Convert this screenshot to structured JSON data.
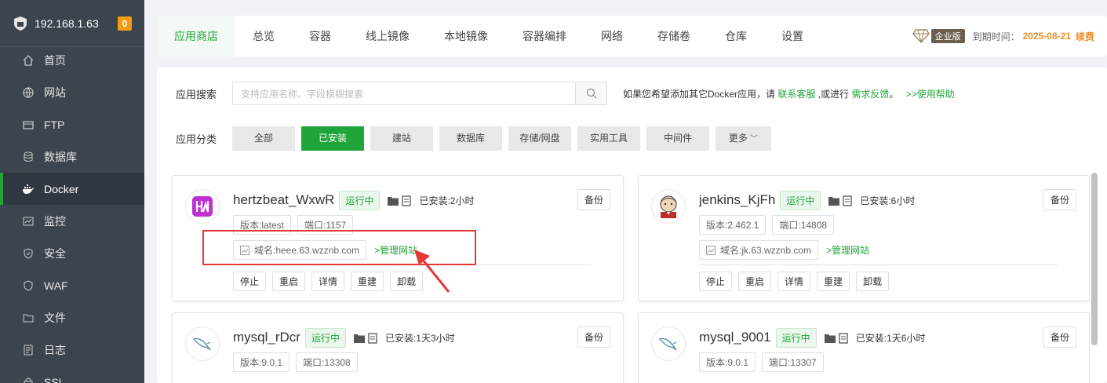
{
  "sidebar": {
    "server_ip": "192.168.1.63",
    "badge": "0",
    "items": [
      {
        "label": "首页",
        "icon": "home-icon"
      },
      {
        "label": "网站",
        "icon": "globe-icon"
      },
      {
        "label": "FTP",
        "icon": "ftp-icon"
      },
      {
        "label": "数据库",
        "icon": "database-icon"
      },
      {
        "label": "Docker",
        "icon": "docker-icon",
        "active": true
      },
      {
        "label": "监控",
        "icon": "monitor-icon"
      },
      {
        "label": "安全",
        "icon": "shield-icon"
      },
      {
        "label": "WAF",
        "icon": "waf-icon"
      },
      {
        "label": "文件",
        "icon": "folder-icon"
      },
      {
        "label": "日志",
        "icon": "log-icon"
      },
      {
        "label": "SSL",
        "icon": "ssl-icon"
      }
    ]
  },
  "tabs": [
    "应用商店",
    "总览",
    "容器",
    "线上镜像",
    "本地镜像",
    "容器编排",
    "网络",
    "存储卷",
    "仓库",
    "设置"
  ],
  "enterprise": {
    "tag": "企业版",
    "expire_label": "到期时间：",
    "date": "2025-08-21",
    "renew": "续费"
  },
  "search": {
    "label": "应用搜索",
    "placeholder": "支持应用名称、字段模糊搜索",
    "hint_prefix": "如果您希望添加其它Docker应用，请 ",
    "hint_link1": "联系客服",
    "hint_mid": " ,或进行 ",
    "hint_link2": "需求反馈",
    "hint_sep": "。 ",
    "hint_link3": ">>使用帮助"
  },
  "category": {
    "label": "应用分类",
    "items": [
      "全部",
      "已安装",
      "建站",
      "数据库",
      "存储/网盘",
      "实用工具",
      "中间件",
      "更多"
    ],
    "active": "已安装"
  },
  "apps": [
    {
      "name": "hertzbeat_WxwR",
      "status": "运行中",
      "installed": "已安装:2小时",
      "version": "版本:latest",
      "port": "端口:1157",
      "domain": "域名:heee.63.wzznb.com",
      "manage": ">管理网站",
      "backup": "备份",
      "actions": [
        "停止",
        "重启",
        "详情",
        "重建",
        "卸载"
      ]
    },
    {
      "name": "jenkins_KjFh",
      "status": "运行中",
      "installed": "已安装:6小时",
      "version": "版本:2.462.1",
      "port": "端口:14808",
      "domain": "域名:jk.63.wzznb.com",
      "manage": ">管理网站",
      "backup": "备份",
      "actions": [
        "停止",
        "重启",
        "详情",
        "重建",
        "卸载"
      ]
    },
    {
      "name": "mysql_rDcr",
      "status": "运行中",
      "installed": "已安装:1天3小时",
      "version": "版本:9.0.1",
      "port": "端口:13308",
      "backup": "备份"
    },
    {
      "name": "mysql_9001",
      "status": "运行中",
      "installed": "已安装:1天6小时",
      "version": "版本:9.0.1",
      "port": "端口:13307",
      "backup": "备份"
    }
  ],
  "colors": {
    "accent": "#20a53a",
    "sidebar": "#3c444d",
    "highlight": "#e53935"
  }
}
